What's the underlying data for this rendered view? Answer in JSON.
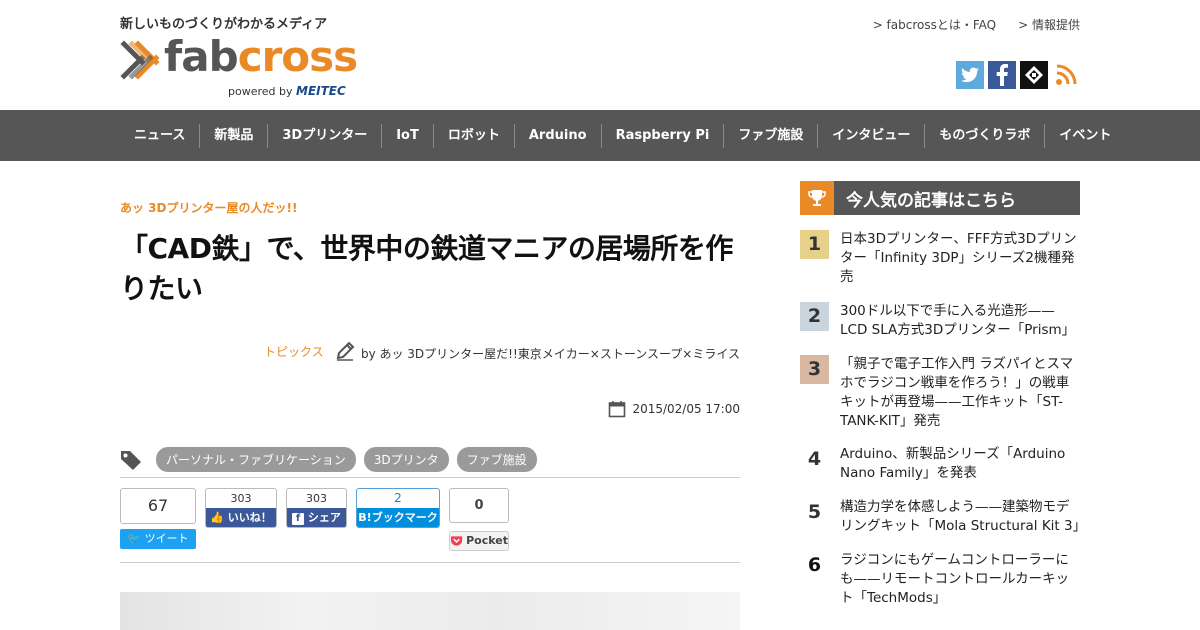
{
  "header": {
    "tagline": "新しいものづくりがわかるメディア",
    "logo_fab": "fab",
    "logo_cross": "cross",
    "powered_by": "powered by",
    "powered_brand": "MEITEC",
    "top_links": [
      "> fabcrossとは・FAQ",
      "> 情報提供"
    ],
    "social_icons": [
      "twitter-icon",
      "facebook-icon",
      "fabcross-icon",
      "rss-icon"
    ]
  },
  "nav": {
    "items": [
      "ニュース",
      "新製品",
      "3Dプリンター",
      "IoT",
      "ロボット",
      "Arduino",
      "Raspberry Pi",
      "ファブ施設",
      "インタビュー",
      "ものづくりラボ",
      "イベント"
    ]
  },
  "article": {
    "kicker": "あッ 3Dプリンター屋の人だッ!!",
    "title": "「CAD鉄」で、世界中の鉄道マニアの居場所を作りたい",
    "category": "トピックス",
    "author": "by あッ 3Dプリンター屋だ!!東京メイカー×ストーンスープ×ミライス",
    "date": "2015/02/05 17:00",
    "tags": [
      "パーソナル・ファブリケーション",
      "3Dプリンタ",
      "ファブ施設"
    ]
  },
  "share": {
    "tweet_count": "67",
    "tweet_label": "ツイート",
    "fb_like_count": "303",
    "fb_like_label": "いいね！",
    "fb_share_count": "303",
    "fb_share_label": "シェア",
    "hatena_count": "2",
    "hatena_label": "B!ブックマーク",
    "pocket_count": "0",
    "pocket_label": "Pocket"
  },
  "sidebar": {
    "heading": "今人気の記事はこちら",
    "ranking": [
      {
        "num": "1",
        "text": "日本3Dプリンター、FFF方式3Dプリンター「Infinity 3DP」シリーズ2機種発売"
      },
      {
        "num": "2",
        "text": "300ドル以下で手に入る光造形——LCD SLA方式3Dプリンター「Prism」"
      },
      {
        "num": "3",
        "text": "「親子で電子工作入門 ラズパイとスマホでラジコン戦車を作ろう！」の戦車キットが再登場——工作キット「ST-TANK-KIT」発売"
      },
      {
        "num": "4",
        "text": "Arduino、新製品シリーズ「Arduino Nano Family」を発表"
      },
      {
        "num": "5",
        "text": "構造力学を体感しよう——建築物モデリングキット「Mola Structural Kit 3」"
      },
      {
        "num": "6",
        "text": "ラジコンにもゲームコントローラーにも——リモートコントロールカーキット「TechMods」"
      }
    ]
  },
  "colors": {
    "accent": "#e98a26",
    "nav_bg": "#565656"
  }
}
